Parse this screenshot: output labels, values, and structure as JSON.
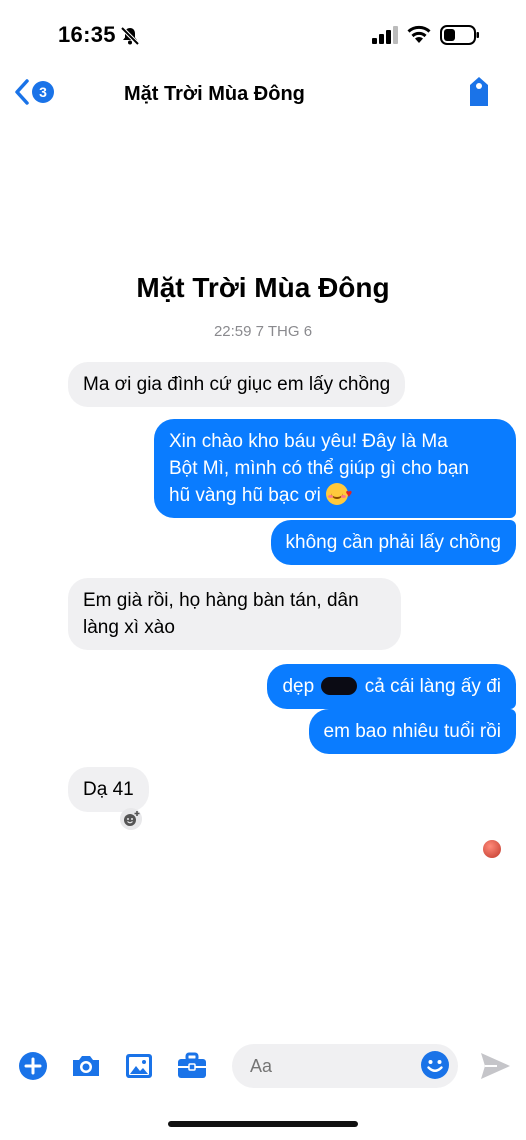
{
  "status_bar": {
    "time": "16:35",
    "icons": [
      "bell-slash-icon",
      "signal-icon",
      "wifi-icon",
      "battery-icon"
    ]
  },
  "header": {
    "back_badge": "3",
    "title": "Mặt Trời Mùa Đông",
    "icons": [
      "chevron-left-icon",
      "tag-icon"
    ]
  },
  "profile": {
    "name": "Mặt Trời Mùa Đông",
    "timestamp": "22:59 7 THG 6"
  },
  "messages": [
    {
      "side": "in",
      "text": "Ma ơi gia đình cứ giục em lấy chồng"
    },
    {
      "side": "out",
      "lines": [
        "Xin chào kho báu yêu! Đây là Ma",
        "Bột Mì, mình có thể giúp gì cho bạn",
        "hũ vàng hũ bạc ơi"
      ],
      "emoji": "smiling-face-with-hearts"
    },
    {
      "side": "out",
      "text": "không cần phải lấy chồng"
    },
    {
      "side": "in",
      "lines": [
        "Em già rồi, họ hàng bàn tán, dân",
        "làng xì xào"
      ]
    },
    {
      "side": "out",
      "text_before": "dẹp",
      "text_after": "cả cái làng ấy đi",
      "redacted": true
    },
    {
      "side": "out",
      "text": "em bao nhiêu tuổi rồi"
    },
    {
      "side": "in",
      "text": "Dạ 41"
    }
  ],
  "composer": {
    "placeholder": "Aa",
    "icons": [
      "plus-circle-icon",
      "camera-icon",
      "image-icon",
      "briefcase-icon",
      "smiley-icon",
      "send-icon"
    ]
  },
  "colors": {
    "accent": "#0a7cff",
    "incoming_bg": "#f0f0f2",
    "icon_blue": "#1a73e8"
  }
}
